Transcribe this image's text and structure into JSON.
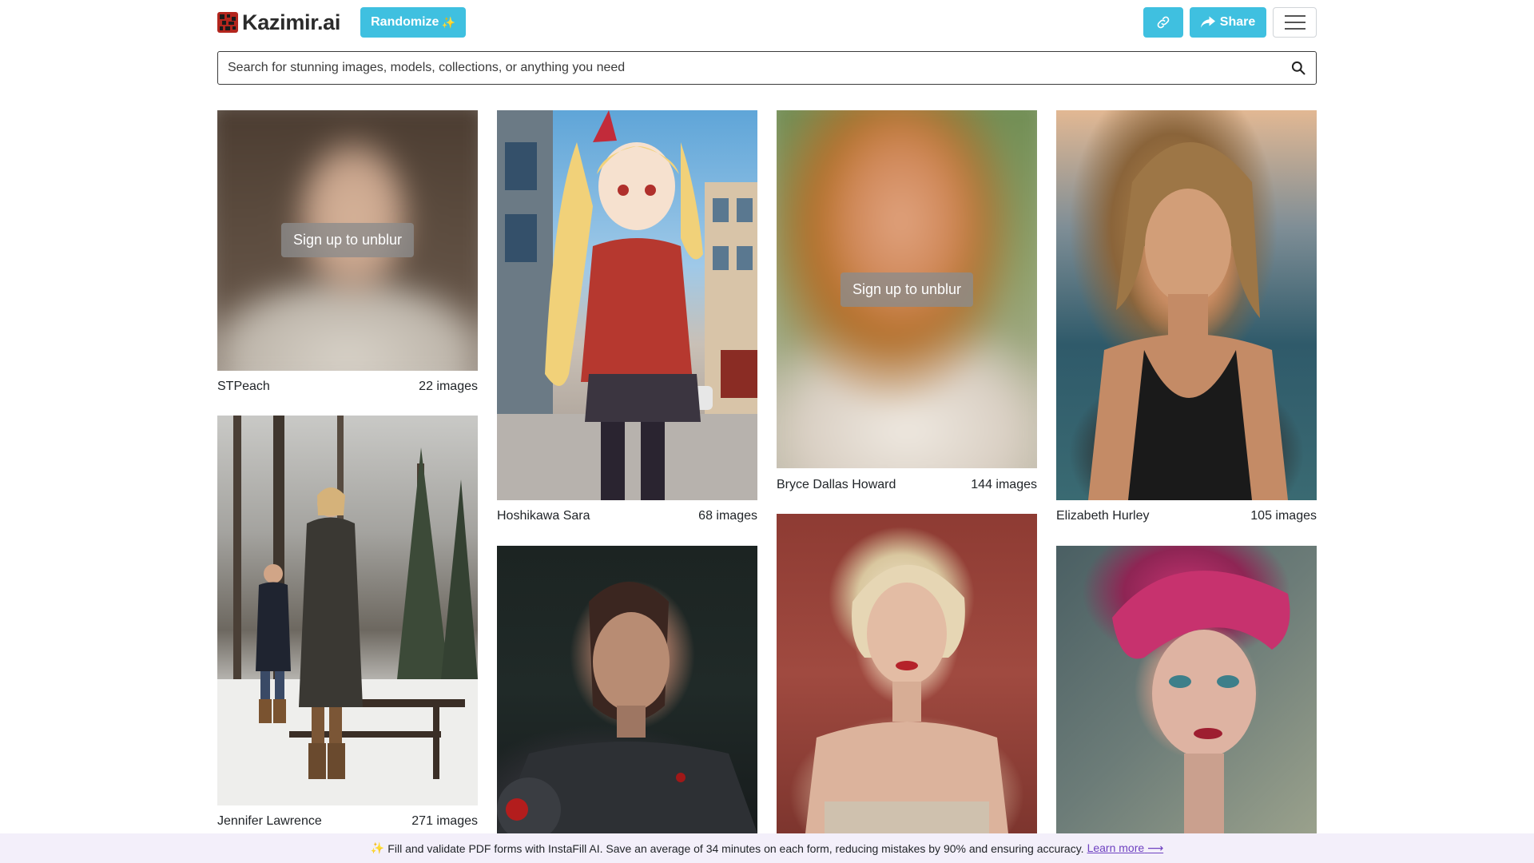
{
  "header": {
    "logo_text": "Kazimir.ai",
    "randomize_label": "Randomize",
    "randomize_emoji": "✨",
    "share_label": "Share",
    "accent_color": "#3fc0e0"
  },
  "search": {
    "placeholder": "Search for stunning images, models, collections, or anything you need"
  },
  "gallery": {
    "unblur_label": "Sign up to unblur",
    "cards": [
      {
        "name": "STPeach",
        "count": "22 images",
        "blurred": true
      },
      {
        "name": "Hoshikawa Sara",
        "count": "68 images",
        "blurred": false
      },
      {
        "name": "Bryce Dallas Howard",
        "count": "144 images",
        "blurred": true
      },
      {
        "name": "Elizabeth Hurley",
        "count": "105 images",
        "blurred": false
      },
      {
        "name": "Jennifer Lawrence",
        "count": "271 images",
        "blurred": false
      },
      {
        "name": "",
        "count": "",
        "blurred": false
      },
      {
        "name": "",
        "count": "",
        "blurred": false
      },
      {
        "name": "",
        "count": "",
        "blurred": false
      }
    ]
  },
  "banner": {
    "emoji": "✨",
    "text": "Fill and validate PDF forms with InstaFill AI. Save an average of 34 minutes on each form, reducing mistakes by 90% and ensuring accuracy.",
    "link_label": "Learn more",
    "link_arrow": "⟶"
  }
}
